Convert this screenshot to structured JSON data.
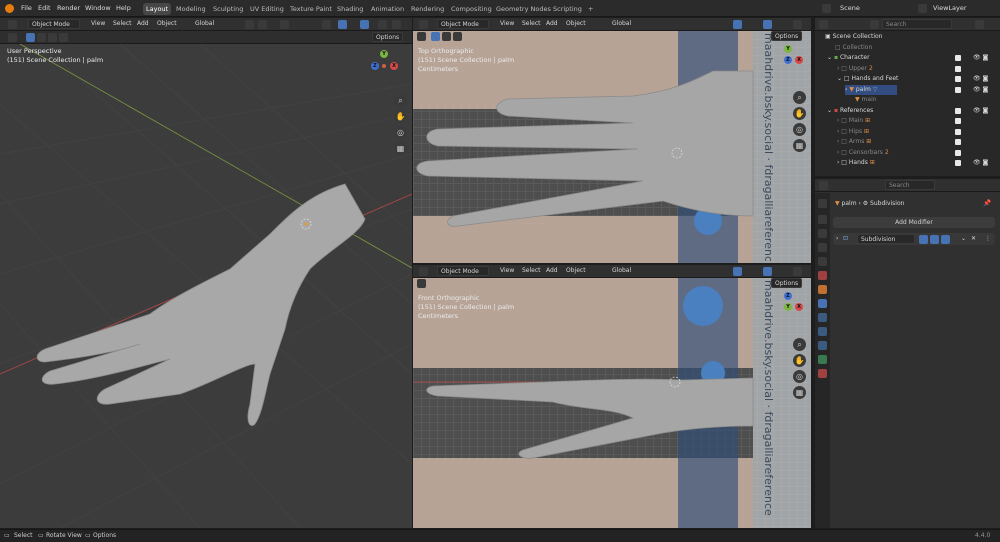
{
  "topbar": {
    "menus": [
      "File",
      "Edit",
      "Render",
      "Window",
      "Help"
    ],
    "workspaces": [
      "Layout",
      "Modeling",
      "Sculpting",
      "UV Editing",
      "Texture Paint",
      "Shading",
      "Animation",
      "Rendering",
      "Compositing",
      "Geometry Nodes",
      "Scripting"
    ],
    "active_workspace": "Layout",
    "add_tab": "+",
    "scene": "Scene",
    "view_layer": "ViewLayer"
  },
  "viewport_main": {
    "mode": "Object Mode",
    "menus": [
      "View",
      "Select",
      "Add",
      "Object"
    ],
    "transform": "Global",
    "options": "Options",
    "overlay_title": "User Perspective",
    "overlay_sub": "(151) Scene Collection | palm"
  },
  "viewport_top": {
    "mode": "Object Mode",
    "menus": [
      "View",
      "Select",
      "Add",
      "Object"
    ],
    "transform": "Global",
    "options": "Options",
    "overlay_title": "Top Orthographic",
    "overlay_sub": "(151) Scene Collection | palm",
    "overlay_units": "Centimeters"
  },
  "viewport_front": {
    "mode": "Object Mode",
    "menus": [
      "View",
      "Select",
      "Add",
      "Object"
    ],
    "transform": "Global",
    "options": "Options",
    "overlay_title": "Front Orthographic",
    "overlay_sub": "(151) Scene Collection | palm",
    "overlay_units": "Centimeters"
  },
  "reference_watermark": "maahdrive.bsky.social · fdragalliareference",
  "gizmo": {
    "x": "X",
    "y": "Y",
    "z": "Z"
  },
  "outliner": {
    "search_placeholder": "Search",
    "rows": [
      {
        "label": "Scene Collection",
        "indent": 0
      },
      {
        "label": "Collection",
        "indent": 1
      },
      {
        "label": "Character",
        "indent": 1
      },
      {
        "label": "Upper",
        "indent": 2
      },
      {
        "label": "Hands and Feet",
        "indent": 2
      },
      {
        "label": "palm",
        "indent": 3
      },
      {
        "label": "main",
        "indent": 3
      },
      {
        "label": "References",
        "indent": 1
      },
      {
        "label": "Main",
        "indent": 2
      },
      {
        "label": "Hips",
        "indent": 2
      },
      {
        "label": "Arms",
        "indent": 2
      },
      {
        "label": "Censorbars",
        "indent": 2
      },
      {
        "label": "Hands",
        "indent": 2
      }
    ],
    "badge_upper": "2",
    "badge_censor": "2"
  },
  "properties": {
    "search_placeholder": "Search",
    "object": "palm",
    "modifier_crumb": "Subdivision",
    "add_modifier": "Add Modifier",
    "modifier_name": "Subdivision"
  },
  "statusbar": {
    "items": [
      "Select",
      "Rotate View",
      "Options"
    ],
    "version": "4.4.0"
  },
  "colors": {
    "accent": "#4772b3",
    "active_tab": "#474747",
    "grid_red": "#c04040",
    "grid_green": "#7aa040",
    "collection_red": "#d04848"
  }
}
